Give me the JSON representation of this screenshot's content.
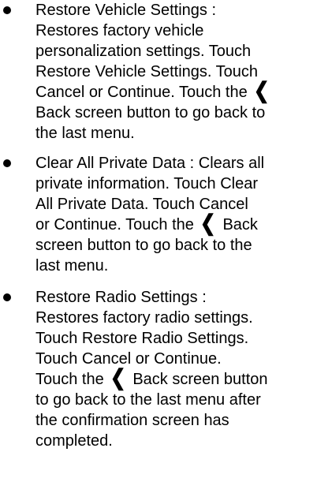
{
  "settings": [
    {
      "part1": "Restore Vehicle Settings :\nRestores factory vehicle\npersonalization settings. Touch\nRestore Vehicle Settings. Touch\nCancel or Continue. Touch the ",
      "icon": "back-chevron-icon",
      "glyph": "❮",
      "part2": "\nBack screen button to go back to\nthe last menu."
    },
    {
      "part1": "Clear All Private Data : Clears all\nprivate information. Touch Clear\nAll Private Data. Touch Cancel\nor Continue. Touch the ",
      "icon": "back-chevron-icon",
      "glyph": "❮",
      "part2": " Back\nscreen button to go back to the\nlast menu."
    },
    {
      "part1": "Restore Radio Settings :\nRestores factory radio settings.\nTouch Restore Radio Settings.\nTouch Cancel or Continue.\nTouch the ",
      "icon": "back-chevron-icon",
      "glyph": "❮",
      "part2": " Back screen button\nto go back to the last menu after\nthe confirmation screen has\ncompleted."
    }
  ]
}
